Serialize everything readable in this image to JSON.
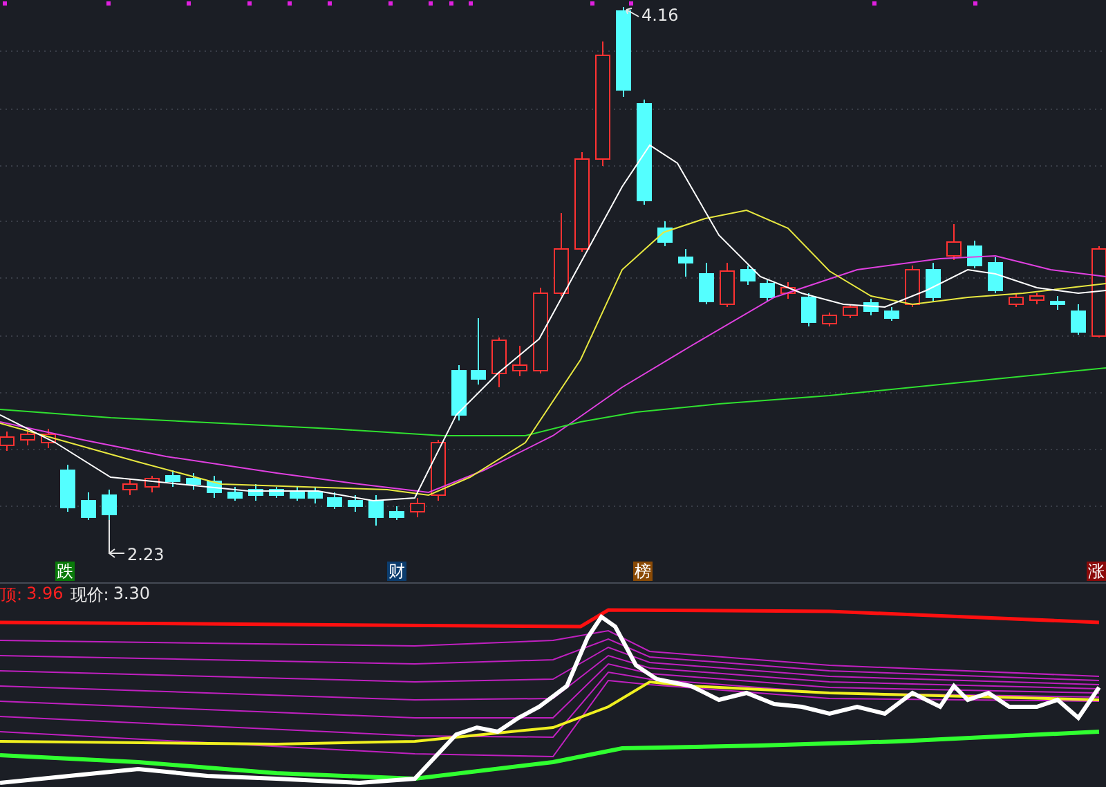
{
  "price_chart": {
    "high_label": "4.16",
    "low_label": "2.23"
  },
  "event_markers": [
    {
      "label": "跌",
      "color": "#0a7a0a"
    },
    {
      "label": "财",
      "color": "#0c3d6e"
    },
    {
      "label": "榜",
      "color": "#8a4a05"
    },
    {
      "label": "涨",
      "color": "#8b0a0a"
    }
  ],
  "indicator": {
    "top_label": "顶:",
    "top_value": "3.96",
    "price_label": "现价:",
    "price_value": "3.30"
  }
}
